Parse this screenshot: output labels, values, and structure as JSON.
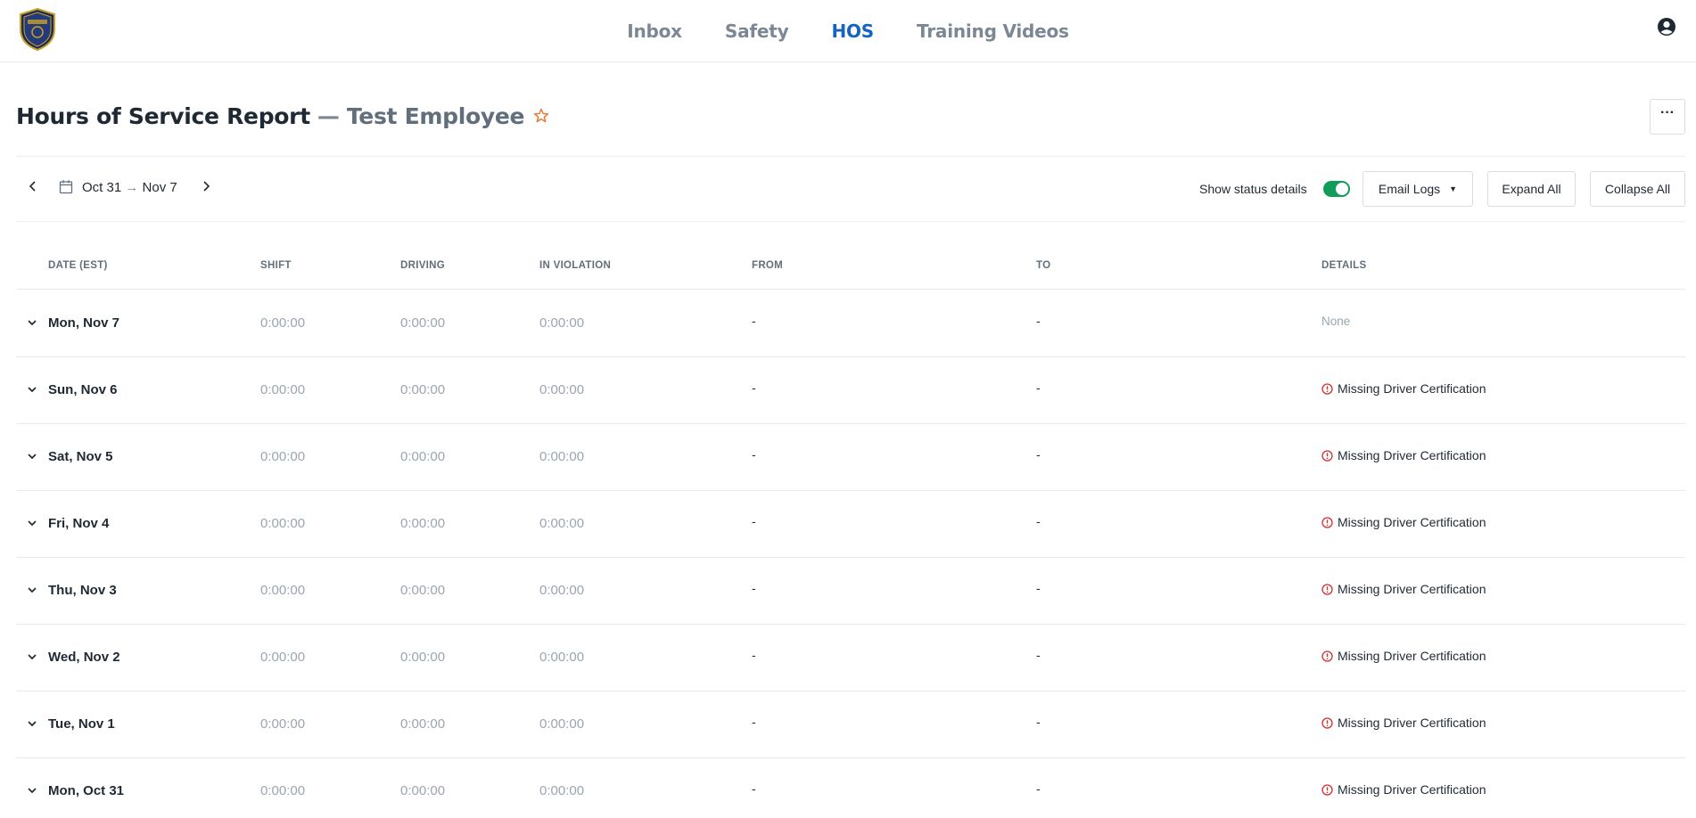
{
  "nav": {
    "items": [
      {
        "label": "Inbox",
        "active": false
      },
      {
        "label": "Safety",
        "active": false
      },
      {
        "label": "HOS",
        "active": true
      },
      {
        "label": "Training Videos",
        "active": false
      }
    ],
    "active_color": "#1565c0"
  },
  "header": {
    "title": "Hours of Service Report",
    "separator": "—",
    "employee": "Test Employee",
    "favorite_icon": "star-icon",
    "more_label": "···"
  },
  "toolbar": {
    "date_start": "Oct 31",
    "date_arrow": "→",
    "date_end": "Nov 7",
    "show_status_label": "Show status details",
    "show_status_on": true,
    "email_logs_label": "Email Logs",
    "email_caret": "▼",
    "expand_all_label": "Expand All",
    "collapse_all_label": "Collapse All"
  },
  "table": {
    "columns": [
      "DATE (EST)",
      "SHIFT",
      "DRIVING",
      "IN VIOLATION",
      "FROM",
      "TO",
      "DETAILS"
    ],
    "rows": [
      {
        "date": "Mon, Nov 7",
        "shift": "0:00:00",
        "driving": "0:00:00",
        "violation": "0:00:00",
        "from": "-",
        "to": "-",
        "details": "None",
        "warning": false
      },
      {
        "date": "Sun, Nov 6",
        "shift": "0:00:00",
        "driving": "0:00:00",
        "violation": "0:00:00",
        "from": "-",
        "to": "-",
        "details": "Missing Driver Certification",
        "warning": true
      },
      {
        "date": "Sat, Nov 5",
        "shift": "0:00:00",
        "driving": "0:00:00",
        "violation": "0:00:00",
        "from": "-",
        "to": "-",
        "details": "Missing Driver Certification",
        "warning": true
      },
      {
        "date": "Fri, Nov 4",
        "shift": "0:00:00",
        "driving": "0:00:00",
        "violation": "0:00:00",
        "from": "-",
        "to": "-",
        "details": "Missing Driver Certification",
        "warning": true
      },
      {
        "date": "Thu, Nov 3",
        "shift": "0:00:00",
        "driving": "0:00:00",
        "violation": "0:00:00",
        "from": "-",
        "to": "-",
        "details": "Missing Driver Certification",
        "warning": true
      },
      {
        "date": "Wed, Nov 2",
        "shift": "0:00:00",
        "driving": "0:00:00",
        "violation": "0:00:00",
        "from": "-",
        "to": "-",
        "details": "Missing Driver Certification",
        "warning": true
      },
      {
        "date": "Tue, Nov 1",
        "shift": "0:00:00",
        "driving": "0:00:00",
        "violation": "0:00:00",
        "from": "-",
        "to": "-",
        "details": "Missing Driver Certification",
        "warning": true
      },
      {
        "date": "Mon, Oct 31",
        "shift": "0:00:00",
        "driving": "0:00:00",
        "violation": "0:00:00",
        "from": "-",
        "to": "-",
        "details": "Missing Driver Certification",
        "warning": true
      }
    ]
  },
  "colors": {
    "warning": "#d32f2f",
    "toggle_on": "#0f9d58",
    "star": "#e8772e"
  }
}
